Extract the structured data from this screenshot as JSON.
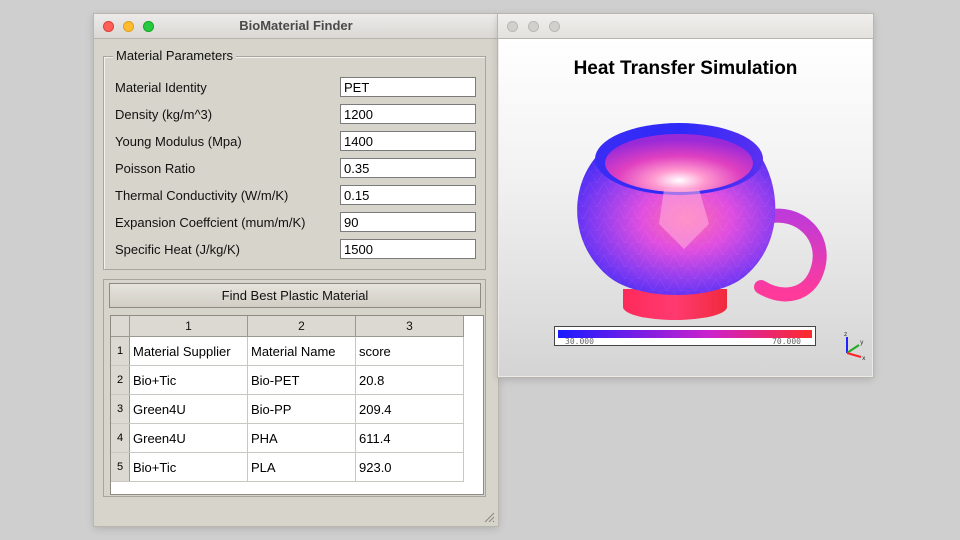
{
  "main_window": {
    "title": "BioMaterial Finder",
    "group_title": "Material Parameters",
    "params": [
      {
        "label": "Material Identity",
        "value": "PET"
      },
      {
        "label": "Density (kg/m^3)",
        "value": "1200"
      },
      {
        "label": "Young Modulus (Mpa)",
        "value": "1400"
      },
      {
        "label": "Poisson Ratio",
        "value": "0.35"
      },
      {
        "label": "Thermal Conductivity (W/m/K)",
        "value": "0.15"
      },
      {
        "label": "Expansion Coeffcient (mum/m/K)",
        "value": "90"
      },
      {
        "label": "Specific Heat (J/kg/K)",
        "value": "1500"
      }
    ],
    "find_button": "Find Best Plastic Material",
    "table": {
      "column_headers": [
        "1",
        "2",
        "3"
      ],
      "row_headers": [
        "1",
        "2",
        "3",
        "4",
        "5"
      ],
      "rows": [
        [
          "Material Supplier",
          "Material Name",
          "score"
        ],
        [
          "Bio+Tic",
          "Bio-PET",
          "20.8"
        ],
        [
          "Green4U",
          "Bio-PP",
          "209.4"
        ],
        [
          "Green4U",
          "PHA",
          "611.4"
        ],
        [
          "Bio+Tic",
          "PLA",
          "923.0"
        ]
      ]
    }
  },
  "sim_window": {
    "title": "Heat Transfer Simulation",
    "colorbar": {
      "min": "30.000",
      "max": "70.000",
      "min_color": "#1a1aff",
      "max_color": "#ff2a2a"
    },
    "axes_labels": {
      "z": "z",
      "y": "y",
      "x": "x"
    }
  },
  "colors": {
    "close": "#ff5f57",
    "minimize": "#febc2e",
    "zoom": "#28c840"
  }
}
